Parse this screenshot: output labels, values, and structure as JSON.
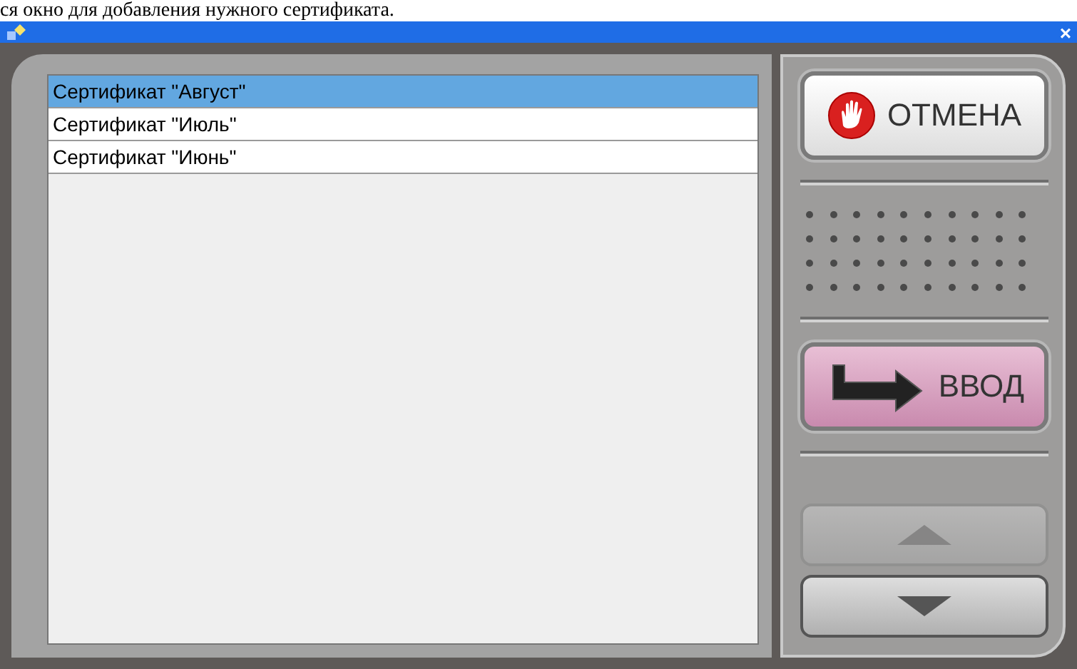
{
  "caption": "ся окно для добавления нужного сертификата.",
  "window": {
    "close": "×"
  },
  "list": {
    "items": [
      {
        "label": "Сертификат \"Август\"",
        "selected": true
      },
      {
        "label": "Сертификат \"Июль\"",
        "selected": false
      },
      {
        "label": "Сертификат \"Июнь\"",
        "selected": false
      }
    ]
  },
  "buttons": {
    "cancel": "ОТМЕНА",
    "enter": "ВВОД"
  },
  "scroll": [
    {
      "kind": "up",
      "disabled": true
    },
    {
      "kind": "down",
      "disabled": false
    }
  ]
}
